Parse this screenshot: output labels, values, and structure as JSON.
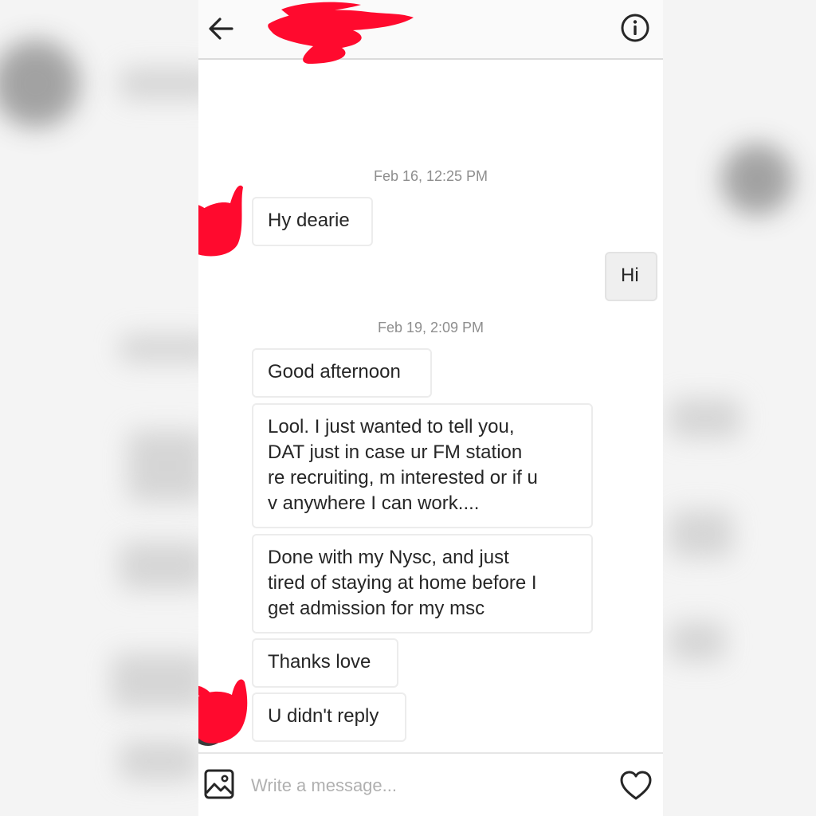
{
  "header": {
    "back_icon": "arrow-left-icon",
    "info_icon": "info-circle-icon"
  },
  "conversation": {
    "groups": [
      {
        "timestamp": "Feb 16, 12:25 PM",
        "messages": [
          {
            "sender": "them",
            "text": "Hy dearie"
          },
          {
            "sender": "me",
            "text": "Hi"
          }
        ]
      },
      {
        "timestamp": "Feb 19, 2:09 PM",
        "messages": [
          {
            "sender": "them",
            "text": "Good afternoon"
          },
          {
            "sender": "them",
            "lines": [
              "Lool. I just wanted to tell you,",
              "DAT just in case ur FM station",
              "re recruiting, m interested or if u",
              "v anywhere I can work...."
            ]
          },
          {
            "sender": "them",
            "lines": [
              "Done with my Nysc, and just",
              "tired of staying at home before I",
              "get admission for my msc"
            ]
          },
          {
            "sender": "them",
            "text": "Thanks love"
          },
          {
            "sender": "them",
            "text": "U didn't reply"
          }
        ]
      }
    ]
  },
  "composer": {
    "placeholder": "Write a message...",
    "gallery_icon": "image-icon",
    "like_icon": "heart-icon"
  },
  "colors": {
    "redaction": "#ff0a2e",
    "timestamp": "#8e8e8e",
    "bubble_border": "#ececec",
    "my_bubble": "#efefef"
  }
}
